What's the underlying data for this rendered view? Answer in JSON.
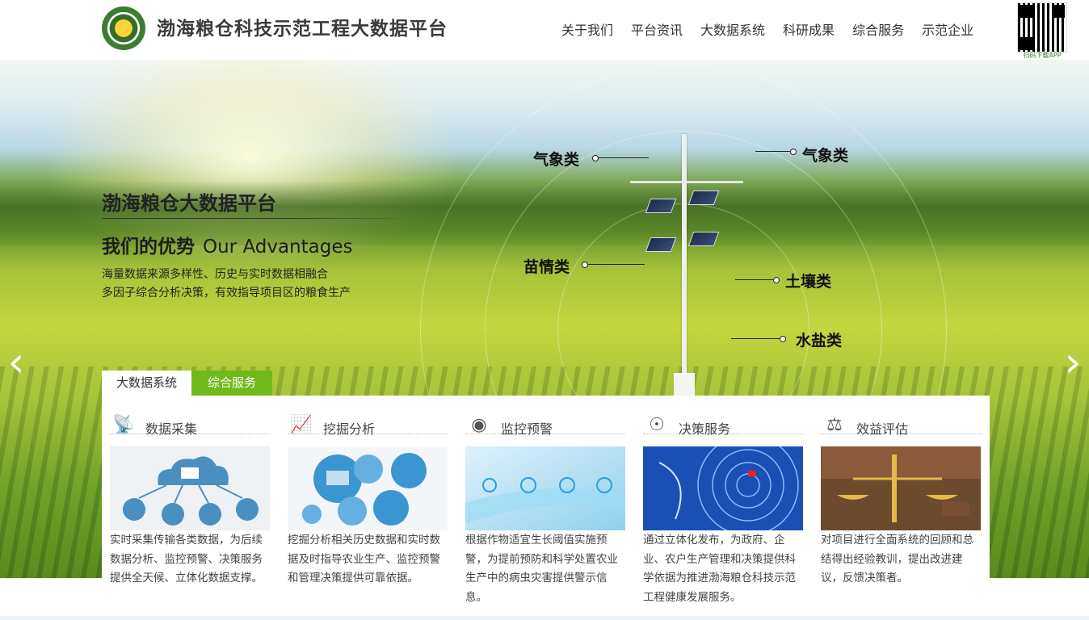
{
  "header": {
    "title": "渤海粮仓科技示范工程大数据平台",
    "nav": [
      "关于我们",
      "平台资讯",
      "大数据系统",
      "科研成果",
      "综合服务",
      "示范企业"
    ],
    "qr_caption": "扫码下载APP"
  },
  "hero": {
    "title": "渤海粮仓大数据平台",
    "subtitle_cn": "我们的优势",
    "subtitle_en": "Our Advantages",
    "line1": "海量数据来源多样性、历史与实时数据相融合",
    "line2": "多因子综合分析决策，有效指导项目区的粮食生产",
    "callouts": [
      "气象类",
      "气象类",
      "苗情类",
      "土壤类",
      "水盐类"
    ],
    "prev_icon": "chevron-left-icon",
    "next_icon": "chevron-right-icon"
  },
  "tabs": [
    "大数据系统",
    "综合服务"
  ],
  "cards": [
    {
      "icon": "satellite-dish-icon",
      "title": "数据采集",
      "text": "实时采集传输各类数据，为后续数据分析、监控预警、决策服务提供全天候、立体化数据支撑。"
    },
    {
      "icon": "chart-monitor-icon",
      "title": "挖掘分析",
      "text": "挖掘分析相关历史数据和实时数据及时指导农业生产、监控预警和管理决策提供可靠依据。"
    },
    {
      "icon": "webcam-icon",
      "title": "监控预警",
      "text": "根据作物适宜生长阈值实施预警，为提前预防和科学处置农业生产中的病虫灾害提供警示信息。"
    },
    {
      "icon": "compass-icon",
      "title": "决策服务",
      "text": "通过立体化发布，为政府、企业、农户生产管理和决策提供科学依据为推进渤海粮仓科技示范工程健康发展服务。"
    },
    {
      "icon": "scales-icon",
      "title": "效益评估",
      "text": "对项目进行全面系统的回顾和总结得出经验教训，提出改进建议，反馈决策者。"
    }
  ],
  "colors": {
    "accent_green": "#6fb91a",
    "title_gray": "#3b3b3b"
  }
}
